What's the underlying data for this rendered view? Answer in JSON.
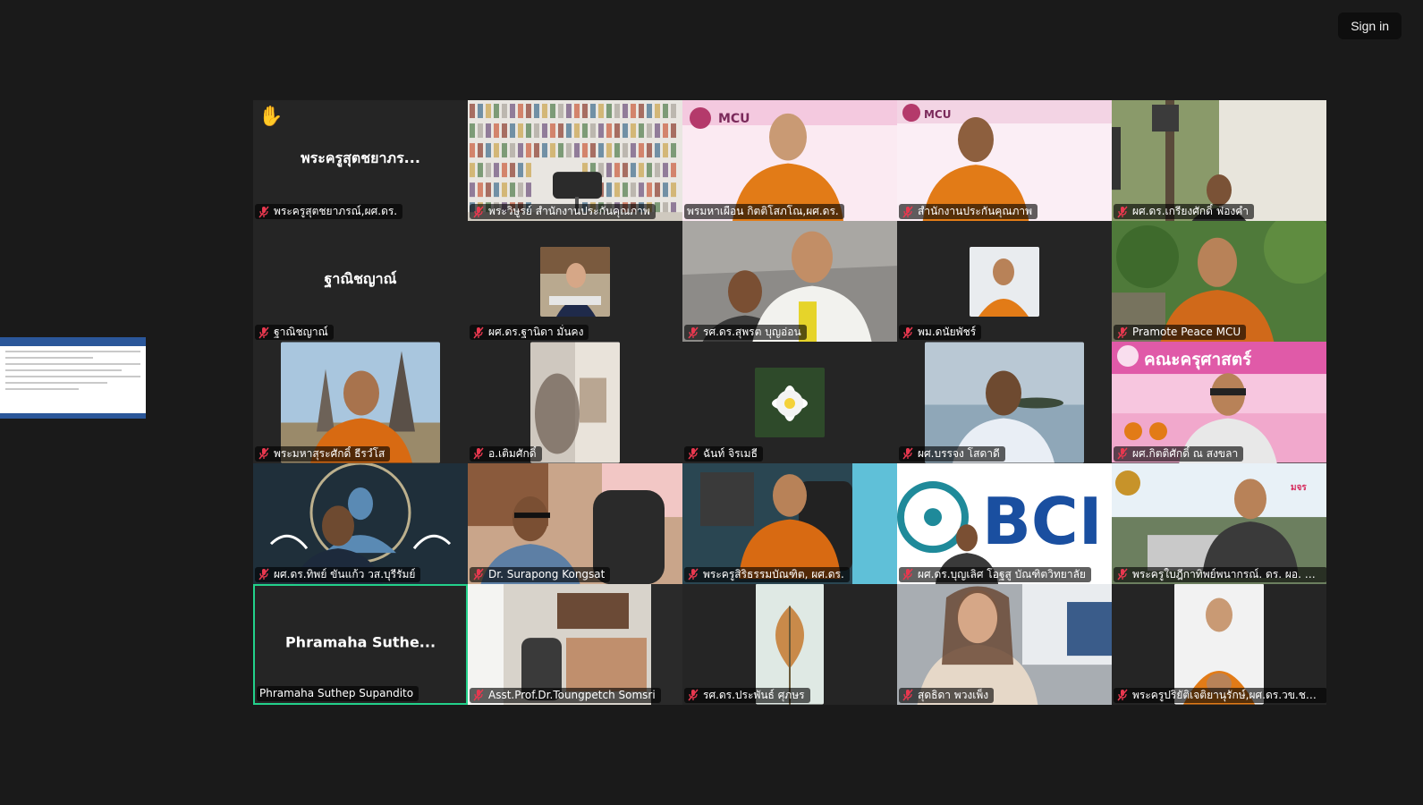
{
  "header": {
    "sign_in": "Sign in"
  },
  "colors": {
    "active_speaker": "#23d18b",
    "mic_muted": "#e8384f",
    "tile_bg": "#252525",
    "page_bg": "#1a1a1a"
  },
  "tiles": [
    {
      "name": "พระครูสุตชยาภรณ์,ผศ.ดร.",
      "display": "พระครูสุตชยาภร...",
      "muted": true,
      "hand_raised": true,
      "visual": "name"
    },
    {
      "name": "พระวิษูรย์ สำนักงานประกันคุณภาพ",
      "muted": true,
      "visual": "bookshelf"
    },
    {
      "name": "พรมหาเผือน กิตติโสภโณ,ผศ.ดร.",
      "muted": false,
      "visual": "monk-banner"
    },
    {
      "name": "สำนักงานประกันคุณภาพ",
      "muted": true,
      "visual": "monk-banner2"
    },
    {
      "name": "ผศ.ดร.เกรียงศักดิ์ ฟองคำ",
      "muted": true,
      "visual": "room"
    },
    {
      "name": "ฐาณิชญาณ์",
      "display": "ฐาณิชญาณ์",
      "muted": true,
      "visual": "name"
    },
    {
      "name": "ผศ.ดร.ฐานิดา มั่นคง",
      "muted": true,
      "visual": "small-woman"
    },
    {
      "name": "รศ.ดร.สุพรต บุญอ่อน",
      "muted": true,
      "visual": "men-hall"
    },
    {
      "name": "พม.ดนัยพัชร์",
      "muted": true,
      "visual": "small-monk"
    },
    {
      "name": "Pramote  Peace  MCU",
      "muted": true,
      "visual": "monk-garden"
    },
    {
      "name": "พระมหาสุระศักดิ์ ธีรวํโส",
      "muted": true,
      "visual": "monk-temple"
    },
    {
      "name": "อ.เติมศักดิ์",
      "muted": true,
      "visual": "blurry"
    },
    {
      "name": "ฉันท์ จิรเมธี",
      "muted": true,
      "visual": "lotus"
    },
    {
      "name": "ผศ.บรรจง โสดาดี",
      "muted": true,
      "visual": "sea-man"
    },
    {
      "name": "ผศ.กิตติศักดิ์ ณ สงขลา",
      "muted": true,
      "visual": "education-banner"
    },
    {
      "name": "ผศ.ดร.ทิพย์ ขันแก้ว วส.บุรีรัมย์",
      "muted": true,
      "visual": "buddha-bg"
    },
    {
      "name": "Dr. Surapong Kongsat",
      "muted": true,
      "visual": "office-man"
    },
    {
      "name": "พระครูสิริธรรมบัณฑิต, ผศ.ดร.",
      "muted": true,
      "visual": "monk-office"
    },
    {
      "name": "ผศ.ดร.บุญเลิศ โอฐสู บัณฑิตวิทยาลัย",
      "muted": true,
      "visual": "bci"
    },
    {
      "name": "พระครูใบฎีกาทิพย์พนากรณ์. ดร. ผอ. สำนั...",
      "muted": true,
      "visual": "campus"
    },
    {
      "name": "Phramaha Suthep Supandito",
      "display": "Phramaha  Suthe...",
      "muted": false,
      "active": true,
      "visual": "name"
    },
    {
      "name": "Asst.Prof.Dr.Toungpetch Somsri",
      "muted": true,
      "visual": "office-room"
    },
    {
      "name": "รศ.ดร.ประพันธ์ ศุภษร",
      "muted": true,
      "visual": "leaf"
    },
    {
      "name": "สุดธิดา พวงเพ็ง",
      "muted": true,
      "visual": "woman-screen"
    },
    {
      "name": "พระครูปริยัติเจติยานุรักษ์,ผศ.ดร.วข.ชม.12...",
      "muted": true,
      "visual": "monk-portrait"
    }
  ]
}
